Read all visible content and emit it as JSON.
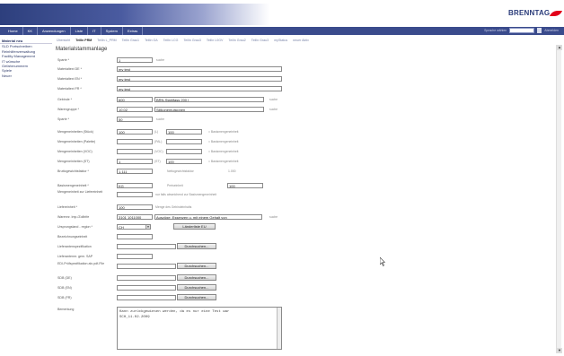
{
  "header": {
    "logo_text": "BRENNTAG"
  },
  "nav": {
    "items": [
      "Home",
      "KK",
      "Anwendungen",
      "Liste",
      "IT",
      "System",
      "Extras"
    ],
    "language": "Sprache wählen",
    "link": "Abmelden"
  },
  "sidebar": {
    "items": [
      "Material neu",
      "SLD Portschreiben",
      "Reinhilfenverwaltung",
      "Facility Management",
      "IT wünsche",
      "Gefahrnummern",
      "Spiele",
      "Neuer"
    ]
  },
  "tabs": [
    "Übersicht",
    "TeilIn PRM",
    "TeilIn L_PRM",
    "TeilIn Grau1",
    "TeilIn GA",
    "TeilIn LCG",
    "TeilIn Grau3",
    "TeilIn L0GV",
    "TeilIn Grau2",
    "TeilIn Grau3",
    "myStatus",
    "neuer Aktiv"
  ],
  "form": {
    "title": "Materialstammanlage",
    "fields": {
      "sparte": {
        "label": "Sparte *",
        "value": "1",
        "hint": "suche"
      },
      "mat_de": {
        "label": "Materialtext DE *",
        "value": "my test"
      },
      "mat_en": {
        "label": "Materialtext EN *",
        "value": "my test"
      },
      "mat_fr": {
        "label": "Materialtext FR *",
        "value": "my test"
      },
      "gebinde": {
        "label": "Gebinde *",
        "code": "600",
        "text": "BRN-Stahlfass 200 l",
        "hint": "suche"
      },
      "warengruppe": {
        "label": "Warengruppe *",
        "code": "10.02",
        "text": "Silikonemulsionen",
        "hint": "suche"
      },
      "sparte2": {
        "label": "Sparte *",
        "value": "50",
        "hint": "suche"
      },
      "menge_stueck": {
        "label": "Mengeneinheiten (Stück)",
        "value": "100",
        "unit": "(L)",
        "conv": "100",
        "hint": "= Basismengeneinheit"
      },
      "menge_palette": {
        "label": "Mengeneinheiten (Palette)",
        "value": "",
        "unit": "(PAL)",
        "conv": "",
        "hint": "= Basismengeneinheit"
      },
      "menge_voc": {
        "label": "Mengeneinheiten (VOC)",
        "value": "",
        "unit": "(VOC)",
        "conv": "",
        "hint": "= Basismengeneinheit"
      },
      "menge_st": {
        "label": "Mengeneinheiten (ST)",
        "value": "1",
        "unit": "(ST)",
        "conv": "100",
        "hint": "= Basismengeneinheit"
      },
      "brutto": {
        "label": "Bruttogewichtsfaktor *",
        "value": "1.111",
        "label2": "Nettogewichtsfaktor",
        "value2": "1.000"
      },
      "basis": {
        "label": "Basismengeneinheit *",
        "value": "KG",
        "label2": "Preiseinheit",
        "value2": "100"
      },
      "menge_lief": {
        "label": "Mengeneinheit zur Liefereinheit",
        "value": "",
        "hint": "nur falls abweichend zur Basismengeneinheit"
      },
      "liefereinheit": {
        "label": "Liefereinheit *",
        "value": "100",
        "hint": "Menge des Gebindeinhalts"
      },
      "warennr": {
        "label": "Warennr. Imp./Zolltrife",
        "code": "3101 1011000",
        "text": "Auszüge, Essenzen u. mit einem Gehalt von",
        "hint": "suche"
      },
      "ursprung": {
        "label": "Ursprungsland - region *",
        "value": "CH",
        "button": "Länderliste EU"
      },
      "bezeichnung": {
        "label": "Bezeichnungseinheit",
        "value": ""
      },
      "lieferant_spez": {
        "label": "Lieferantenspezifikation",
        "value": "",
        "button": "Durchsuchen..."
      },
      "lieferant_nr": {
        "label": "Lieferantennr. gem. SAP",
        "value": ""
      },
      "edi": {
        "label": "EDI-Prüfspezifikation als pdf-File",
        "value": "",
        "button": "Durchsuchen..."
      },
      "sdb_de": {
        "label": "SDB (DE)",
        "value": "",
        "button": "Durchsuchen..."
      },
      "sdb_en": {
        "label": "SDB (EN)",
        "value": "",
        "button": "Durchsuchen..."
      },
      "sdb_fr": {
        "label": "SDB (FR)",
        "value": "",
        "button": "Durchsuchen..."
      },
      "bemerkung": {
        "label": "Bemerkung",
        "value": "Kann zurückgewiesen werden, da es nur eine Test war\nSCH_11.02.2009"
      }
    }
  }
}
